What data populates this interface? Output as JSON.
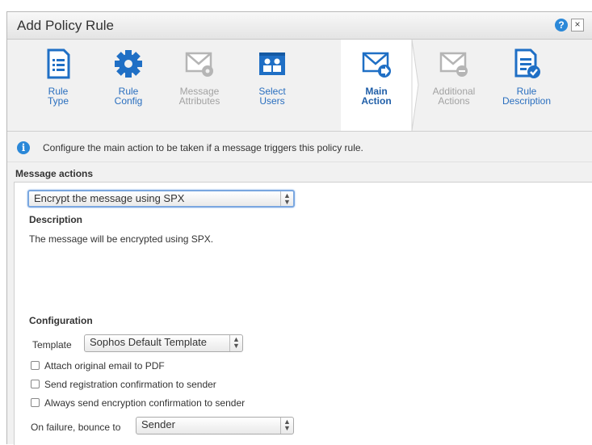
{
  "window": {
    "title": "Add Policy Rule",
    "help_label": "?",
    "close_label": "×"
  },
  "wizard_steps": [
    {
      "label": "Rule\nType",
      "state": "enabled",
      "icon": "rule-type-icon"
    },
    {
      "label": "Rule\nConfig",
      "state": "enabled",
      "icon": "gear-icon"
    },
    {
      "label": "Message\nAttributes",
      "state": "disabled",
      "icon": "envelope-gear-icon"
    },
    {
      "label": "Select\nUsers",
      "state": "enabled",
      "icon": "users-icon"
    },
    {
      "label": "Main\nAction",
      "state": "active",
      "icon": "envelope-arrow-icon"
    },
    {
      "label": "Additional\nActions",
      "state": "disabled",
      "icon": "envelope-plus-icon"
    },
    {
      "label": "Rule\nDescription",
      "state": "enabled",
      "icon": "document-check-icon"
    }
  ],
  "info": {
    "icon_label": "i",
    "text": "Configure the main action to be taken if a message triggers this policy rule."
  },
  "message_actions": {
    "heading": "Message actions",
    "selected": "Encrypt the message using SPX",
    "description_heading": "Description",
    "description_text": "The message will be encrypted using SPX."
  },
  "configuration": {
    "heading": "Configuration",
    "template_label": "Template",
    "template_value": "Sophos Default Template",
    "checkboxes": [
      {
        "label": "Attach original email to PDF",
        "checked": false
      },
      {
        "label": "Send registration confirmation to sender",
        "checked": false
      },
      {
        "label": "Always send encryption confirmation to sender",
        "checked": false
      }
    ],
    "bounce_label": "On failure, bounce to",
    "bounce_value": "Sender"
  },
  "select_arrows": "▲\n▼",
  "colors": {
    "accent_blue": "#2a6fbf",
    "disabled_gray": "#a2a2a2",
    "info_blue": "#2b88d8"
  }
}
